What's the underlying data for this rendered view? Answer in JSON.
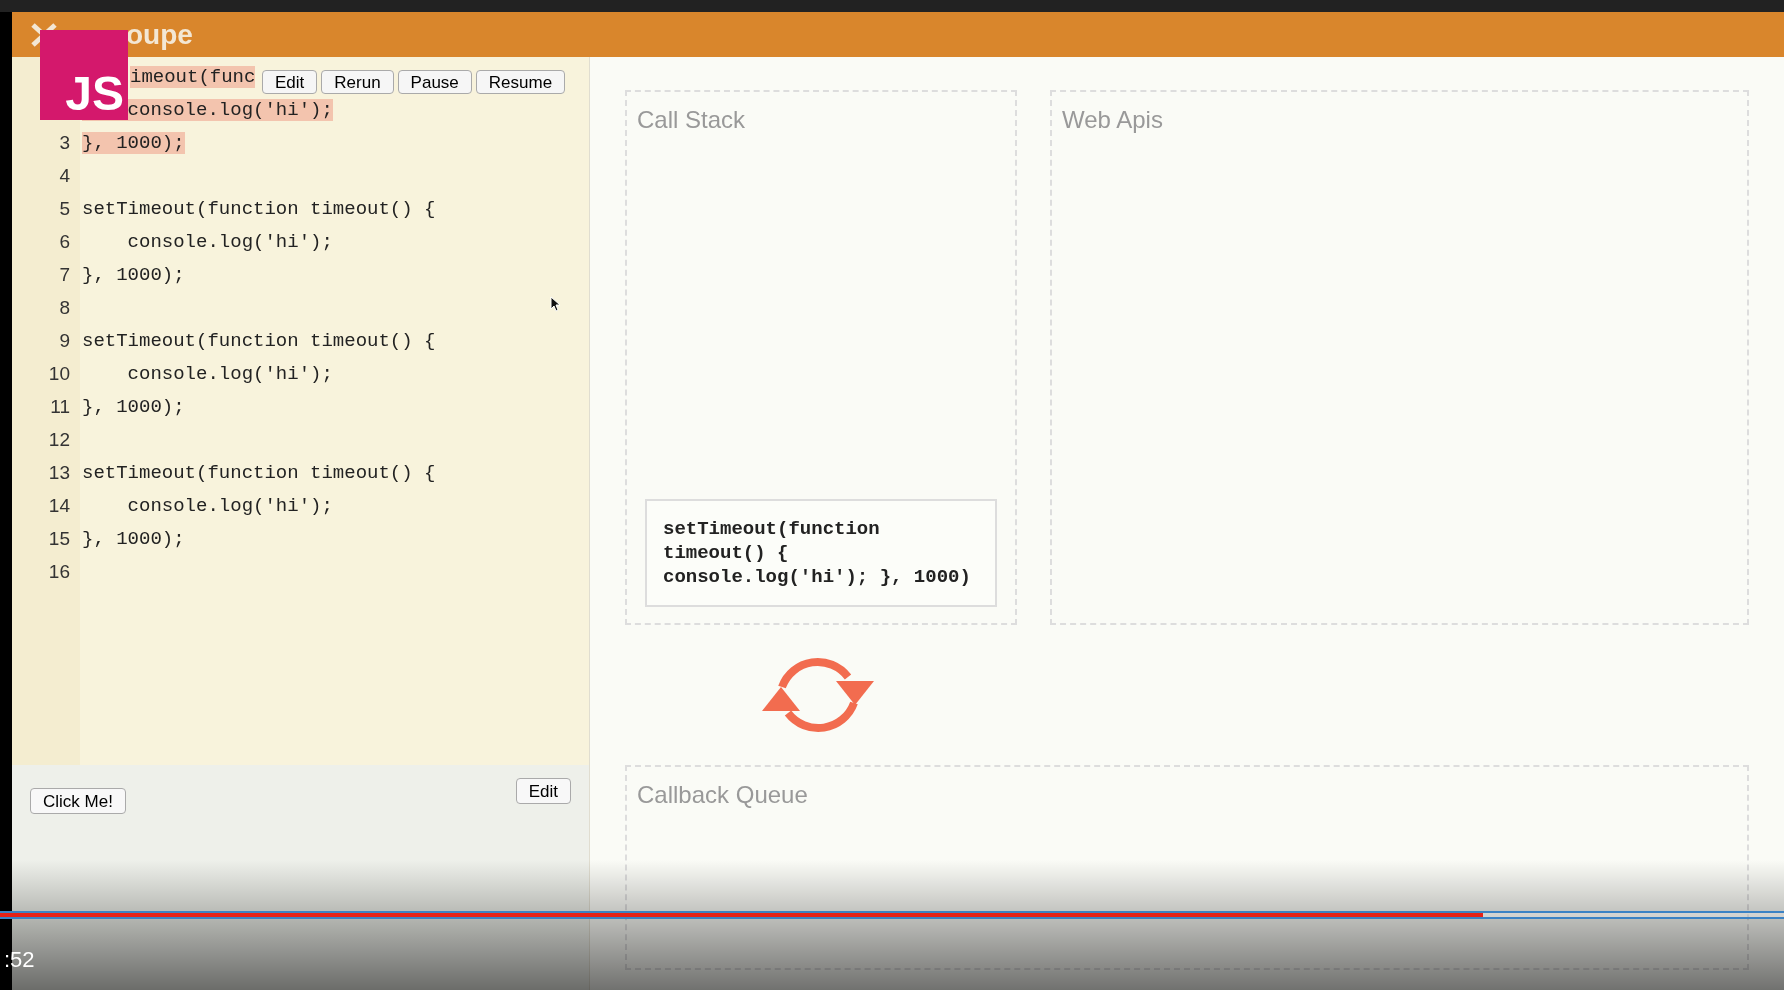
{
  "app": {
    "title": "oupe",
    "logo": "JS"
  },
  "editor": {
    "buttons": [
      "Edit",
      "Rerun",
      "Pause",
      "Resume"
    ],
    "lines": [
      {
        "text": "imeout(func",
        "highlighted": true
      },
      {
        "text": "    console.log('hi');",
        "highlighted": true
      },
      {
        "number": "3",
        "text": "}, 1000);",
        "highlighted": true
      },
      {
        "number": "4",
        "highlighted": false
      },
      {
        "number": "5",
        "text": "setTimeout(function timeout() {",
        "highlighted": false
      },
      {
        "number": "6",
        "text": "    console.log('hi');",
        "highlighted": false
      },
      {
        "number": "7",
        "text": "}, 1000);",
        "highlighted": false
      },
      {
        "number": "8",
        "highlighted": false
      },
      {
        "number": "9",
        "text": "setTimeout(function timeout() {",
        "highlighted": false
      },
      {
        "number": "10",
        "text": "    console.log('hi');",
        "highlighted": false
      },
      {
        "number": "11",
        "text": "}, 1000);",
        "highlighted": false
      },
      {
        "number": "12",
        "highlighted": false
      },
      {
        "number": "13",
        "text": "setTimeout(function timeout() {",
        "highlighted": false
      },
      {
        "number": "14",
        "text": "    console.log('hi');",
        "highlighted": false
      },
      {
        "number": "15",
        "text": "}, 1000);",
        "highlighted": false
      },
      {
        "number": "16",
        "highlighted": false
      }
    ]
  },
  "html_panel": {
    "button": "Click Me!",
    "edit_button": "Edit"
  },
  "call_stack": {
    "title": "Call Stack",
    "frames": [
      "setTimeout(function timeout() { console.log('hi'); }, 1000)"
    ]
  },
  "web_apis": {
    "title": "Web Apis"
  },
  "callback_queue": {
    "title": "Callback Queue"
  },
  "video": {
    "time": ":52",
    "progress": {
      "level": 0.831
    }
  }
}
